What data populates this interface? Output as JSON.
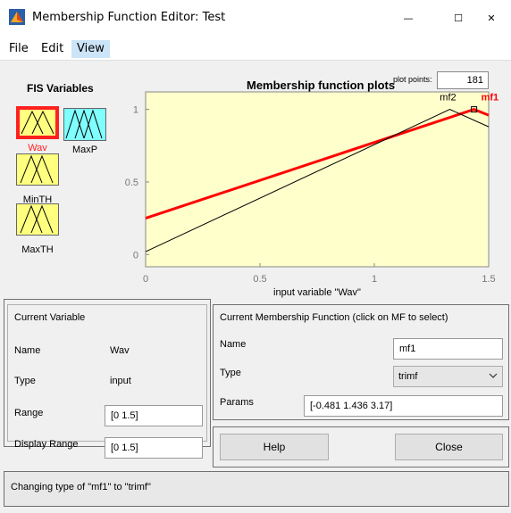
{
  "window": {
    "title": "Membership Function Editor: Test",
    "minimize": "—",
    "maximize": "☐",
    "close": "✕"
  },
  "menu": [
    "File",
    "Edit",
    "View"
  ],
  "fis": {
    "title": "FIS Variables",
    "variables": [
      {
        "name": "Wav",
        "selected": true,
        "color": "#ffff80"
      },
      {
        "name": "MaxP",
        "selected": false,
        "color": "#80ffff"
      },
      {
        "name": "MinTH",
        "selected": false,
        "color": "#ffff80"
      },
      {
        "name": "MaxTH",
        "selected": false,
        "color": "#ffff80"
      }
    ]
  },
  "plot": {
    "title": "Membership function plots",
    "points_label": "plot points:",
    "points_value": "181",
    "xlabel": "input variable \"Wav\"",
    "x_ticks": [
      "0",
      "0.5",
      "1",
      "1.5"
    ],
    "y_ticks": [
      "0",
      "0.5",
      "1"
    ],
    "mf_labels": [
      "mf2",
      "mf1"
    ]
  },
  "chart_data": {
    "type": "line",
    "xlim": [
      0,
      1.5
    ],
    "ylim": [
      0,
      1
    ],
    "series": [
      {
        "name": "mf1",
        "color": "#ff0000",
        "x": [
          0,
          1.436,
          1.5
        ],
        "y": [
          0.25,
          1.0,
          0.96
        ]
      },
      {
        "name": "mf2",
        "color": "#000000",
        "x": [
          0,
          1.33,
          1.5
        ],
        "y": [
          0.02,
          1.0,
          0.88
        ]
      }
    ]
  },
  "current_variable": {
    "title": "Current Variable",
    "name_label": "Name",
    "name_value": "Wav",
    "type_label": "Type",
    "type_value": "input",
    "range_label": "Range",
    "range_value": "[0 1.5]",
    "display_label": "Display Range",
    "display_value": "[0 1.5]"
  },
  "current_mf": {
    "title": "Current Membership Function (click on MF to select)",
    "name_label": "Name",
    "name_value": "mf1",
    "type_label": "Type",
    "type_value": "trimf",
    "params_label": "Params",
    "params_value": "[-0.481 1.436 3.17]"
  },
  "buttons": {
    "help": "Help",
    "close": "Close"
  },
  "status": "Changing type of \"mf1\" to \"trimf\""
}
